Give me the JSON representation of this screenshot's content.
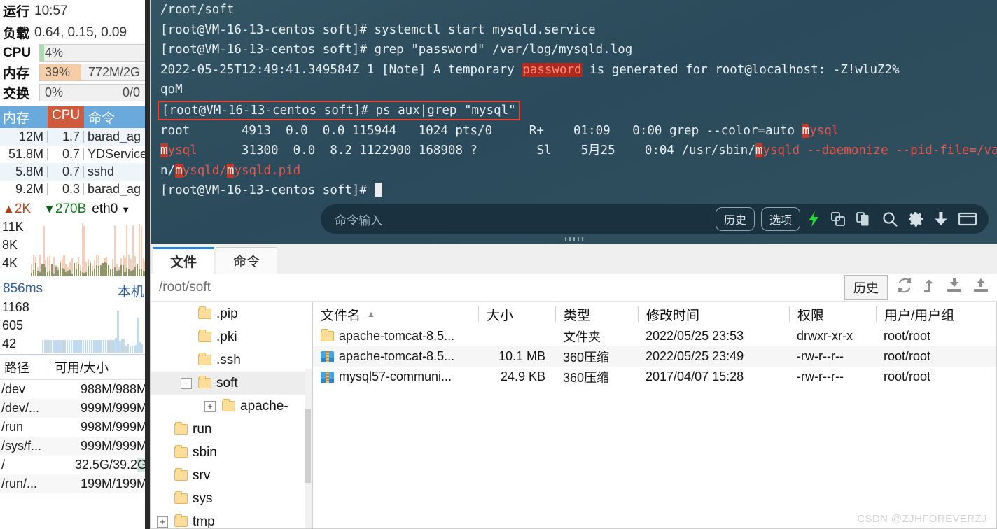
{
  "sidebar": {
    "uptime": {
      "label": "运行",
      "value": "10:57"
    },
    "load": {
      "label": "负载",
      "value": "0.64, 0.15, 0.09"
    },
    "cpu": {
      "label": "CPU",
      "percent": "4%",
      "fill_pct": 4,
      "fill_color": "#a8dca8",
      "abs": ""
    },
    "mem": {
      "label": "内存",
      "percent": "39%",
      "fill_pct": 39,
      "fill_color": "#f7cda6",
      "abs": "772M/2G"
    },
    "swap": {
      "label": "交换",
      "percent": "0%",
      "fill_pct": 0,
      "fill_color": "#f7cda6",
      "abs": "0/0"
    },
    "proc_table": {
      "headers": [
        "内存",
        "CPU",
        "命令"
      ],
      "rows": [
        {
          "mem": "12M",
          "cpu": "1.7",
          "cmd": "barad_ag"
        },
        {
          "mem": "51.8M",
          "cpu": "0.7",
          "cmd": "YDService"
        },
        {
          "mem": "5.8M",
          "cpu": "0.7",
          "cmd": "sshd"
        },
        {
          "mem": "9.2M",
          "cpu": "0.3",
          "cmd": "barad_ag"
        }
      ]
    },
    "net": {
      "up": "2K",
      "down": "270B",
      "iface": "eth0"
    },
    "net_graph": {
      "ticks": [
        "11K",
        "8K",
        "4K"
      ]
    },
    "latency": {
      "value": "856ms",
      "host": "本机",
      "ticks": [
        "1168",
        "605",
        "42"
      ]
    },
    "disk": {
      "headers": [
        "路径",
        "可用/大小"
      ],
      "rows": [
        {
          "path": "/dev",
          "size": "988M/988M",
          "highlight": ""
        },
        {
          "path": "/dev/...",
          "size": "999M/999M",
          "highlight": ""
        },
        {
          "path": "/run",
          "size": "998M/999M",
          "highlight": ""
        },
        {
          "path": "/sys/f...",
          "size": "999M/999M",
          "highlight": ""
        },
        {
          "path": "/",
          "size": "32.5G/39.2",
          "highlight": "G"
        },
        {
          "path": "/run/...",
          "size": "199M/199M",
          "highlight": ""
        }
      ]
    }
  },
  "terminal": {
    "cwd": "/root/soft",
    "prompt": "[root@VM-16-13-centos soft]#",
    "lines": {
      "l1": "[root@VM-16-13-centos soft]# systemctl start mysqld.service",
      "l2": "[root@VM-16-13-centos soft]# grep \"password\" /var/log/mysqld.log",
      "l3a": "2022-05-25T12:49:41.349584Z 1 [Note] A temporary ",
      "l3b": "password",
      "l3c": " is generated for root@localhost: -Z!wluZ2%",
      "l4": "qoM",
      "l5": "[root@VM-16-13-centos soft]# ps aux|grep \"mysql\"",
      "l6": "root       4913  0.0  0.0 115944   1024 pts/0     R+    01:09   0:00 grep --color=auto ",
      "l6m": "m",
      "l6b": "ysql",
      "l7m": "m",
      "l7a": "ysql",
      "l7b": "      31300  0.0  8.2 1122900 168908 ?        Sl    5月25    0:04 /usr/sbin/",
      "l7c": "ysqld --daemonize --pid-file=/var/ru",
      "l8a": "n/",
      "l8b": "ysqld/",
      "l8c": "ysqld.pid",
      "l9": "[root@VM-16-13-centos soft]# "
    },
    "input": {
      "placeholder": "命令输入"
    },
    "toolbar": {
      "history_label": "历史",
      "options_label": "选项",
      "icons": [
        "lightning-icon",
        "copy-icon",
        "paste-icon",
        "search-icon",
        "gear-icon",
        "download-icon",
        "window-icon"
      ]
    }
  },
  "filemanager": {
    "tabs": [
      {
        "label": "文件",
        "active": true
      },
      {
        "label": "命令",
        "active": false
      }
    ],
    "path": "/root/soft",
    "history_label": "历史",
    "path_icons": [
      "refresh-icon",
      "parent-dir-icon",
      "download-icon",
      "upload-icon"
    ],
    "tree": [
      {
        "label": ".pip",
        "depth": 2,
        "toggle": "",
        "selected": false,
        "icon": "folder-icon"
      },
      {
        "label": ".pki",
        "depth": 2,
        "toggle": "",
        "selected": false,
        "icon": "folder-icon"
      },
      {
        "label": ".ssh",
        "depth": 2,
        "toggle": "",
        "selected": false,
        "icon": "folder-icon"
      },
      {
        "label": "soft",
        "depth": 2,
        "toggle": "−",
        "selected": true,
        "icon": "folder-icon"
      },
      {
        "label": "apache-",
        "depth": 3,
        "toggle": "+",
        "selected": false,
        "icon": "folder-icon"
      },
      {
        "label": "run",
        "depth": 1,
        "toggle": "",
        "selected": false,
        "icon": "folder-icon"
      },
      {
        "label": "sbin",
        "depth": 1,
        "toggle": "",
        "selected": false,
        "icon": "folder-link-icon"
      },
      {
        "label": "srv",
        "depth": 1,
        "toggle": "",
        "selected": false,
        "icon": "folder-icon"
      },
      {
        "label": "sys",
        "depth": 1,
        "toggle": "",
        "selected": false,
        "icon": "folder-icon"
      },
      {
        "label": "tmp",
        "depth": 1,
        "toggle": "+",
        "selected": false,
        "icon": "folder-icon"
      }
    ],
    "list": {
      "headers": [
        "文件名",
        "大小",
        "类型",
        "修改时间",
        "权限",
        "用户/用户组"
      ],
      "sort_col": "文件名",
      "rows": [
        {
          "icon": "folder-icon",
          "name": "apache-tomcat-8.5...",
          "size": "",
          "type": "文件夹",
          "time": "2022/05/25 23:53",
          "perm": "drwxr-xr-x",
          "owner": "root/root"
        },
        {
          "icon": "zip-icon",
          "name": "apache-tomcat-8.5...",
          "size": "10.1 MB",
          "type": "360压缩",
          "time": "2022/05/25 23:49",
          "perm": "-rw-r--r--",
          "owner": "root/root"
        },
        {
          "icon": "zip-icon",
          "name": "mysql57-communi...",
          "size": "24.9 KB",
          "type": "360压缩",
          "time": "2017/04/07 15:28",
          "perm": "-rw-r--r--",
          "owner": "root/root"
        }
      ]
    }
  },
  "watermark": "CSDN @ZJHFOREVERZJ",
  "colors": {
    "accent_blue": "#1a84e2",
    "terminal_bg": "#2e4e5e",
    "highlight_red": "#f0402c",
    "cpu_header": "#cf5a3c",
    "proc_header": "#6aa9dc"
  }
}
